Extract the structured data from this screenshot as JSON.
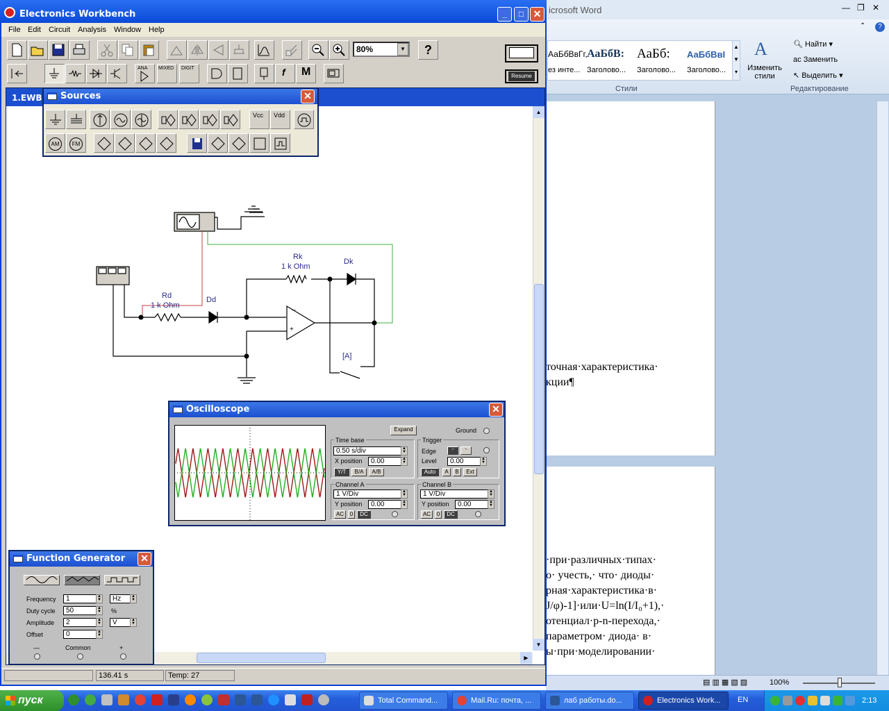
{
  "app": {
    "title": "Electronics Workbench"
  },
  "menu": [
    "File",
    "Edit",
    "Circuit",
    "Analysis",
    "Window",
    "Help"
  ],
  "zoom": "80%",
  "toolbar": {
    "help": "?",
    "resume": "Resume",
    "misc_m": "M",
    "ana": "ANA",
    "mixed": "MIXED",
    "digit": "DIGIT",
    "f": "f"
  },
  "document_tab": "1.EWB",
  "sources": {
    "title": "Sources",
    "vcc": "Vcc",
    "vdd": "Vdd",
    "am": "AM",
    "fm": "FM"
  },
  "circuit": {
    "rk_name": "Rk",
    "rk_value": "1 k Ohm",
    "rd_name": "Rd",
    "rd_value": "1 k Ohm",
    "dk": "Dk",
    "dd": "Dd",
    "switch": "[A]"
  },
  "oscilloscope": {
    "title": "Oscilloscope",
    "expand": "Expand",
    "ground": "Ground",
    "time_base": "Time base",
    "time_value": "0.50 s/div",
    "x_position": "X position",
    "x_value": "0.00",
    "yt": "Y/T",
    "ba": "B/A",
    "ab": "A/B",
    "trigger": "Trigger",
    "edge": "Edge",
    "level": "Level",
    "level_value": "0.00",
    "auto": "Auto",
    "a": "A",
    "b": "B",
    "ext": "Ext",
    "channel_a": "Channel A",
    "cha_value": "1  V/Div",
    "y_position": "Y position",
    "ya_value": "0.00",
    "channel_b": "Channel B",
    "chb_value": "1  V/Div",
    "yb_value": "0.00",
    "ac": "AC",
    "zero": "0",
    "dc": "DC"
  },
  "function_generator": {
    "title": "Function Generator",
    "frequency_label": "Frequency",
    "frequency": "1",
    "frequency_unit": "Hz",
    "duty_label": "Duty cycle",
    "duty": "50",
    "duty_unit": "%",
    "amplitude_label": "Amplitude",
    "amplitude": "2",
    "amplitude_unit": "V",
    "offset_label": "Offset",
    "offset": "0",
    "minus": "—",
    "common": "Common",
    "plus": "+"
  },
  "status": {
    "time": "136.41 s",
    "temp": "Temp:  27"
  },
  "word": {
    "title_fragment": "icrosoft Word",
    "styles": [
      "АаБбВвГг,",
      "АаБбВ:",
      "АаБб:",
      "АаБбВвI"
    ],
    "style_names": [
      "ез инте...",
      "Заголово...",
      "Заголово...",
      "Заголово..."
    ],
    "change_styles": "Изменить стили",
    "styles_group": "Стили",
    "find": "Найти",
    "replace": "Заменить",
    "select": "Выделить",
    "editing_group": "Редактирование",
    "text1": "точная·характеристика·",
    "text2": "кции¶",
    "text3": "·при·различных·типах·",
    "text4": "о·  учесть,·  что·  диоды·",
    "text5": "рная·характеристика·в·",
    "text6": "J/φ)-1]·или·U=ln(I/I₀+1),·",
    "text7": "отенциал·p-n-перехода,·",
    "text8": "параметром·  диода·  в·",
    "text9": "ы·при·моделировании·",
    "zoom": "100%"
  },
  "taskbar": {
    "start": "пуск",
    "items": [
      "Total Command...",
      "Mail.Ru: почта, ...",
      "лаб работы.do...",
      "Electronics Work..."
    ],
    "lang": "EN",
    "clock": "2:13"
  }
}
